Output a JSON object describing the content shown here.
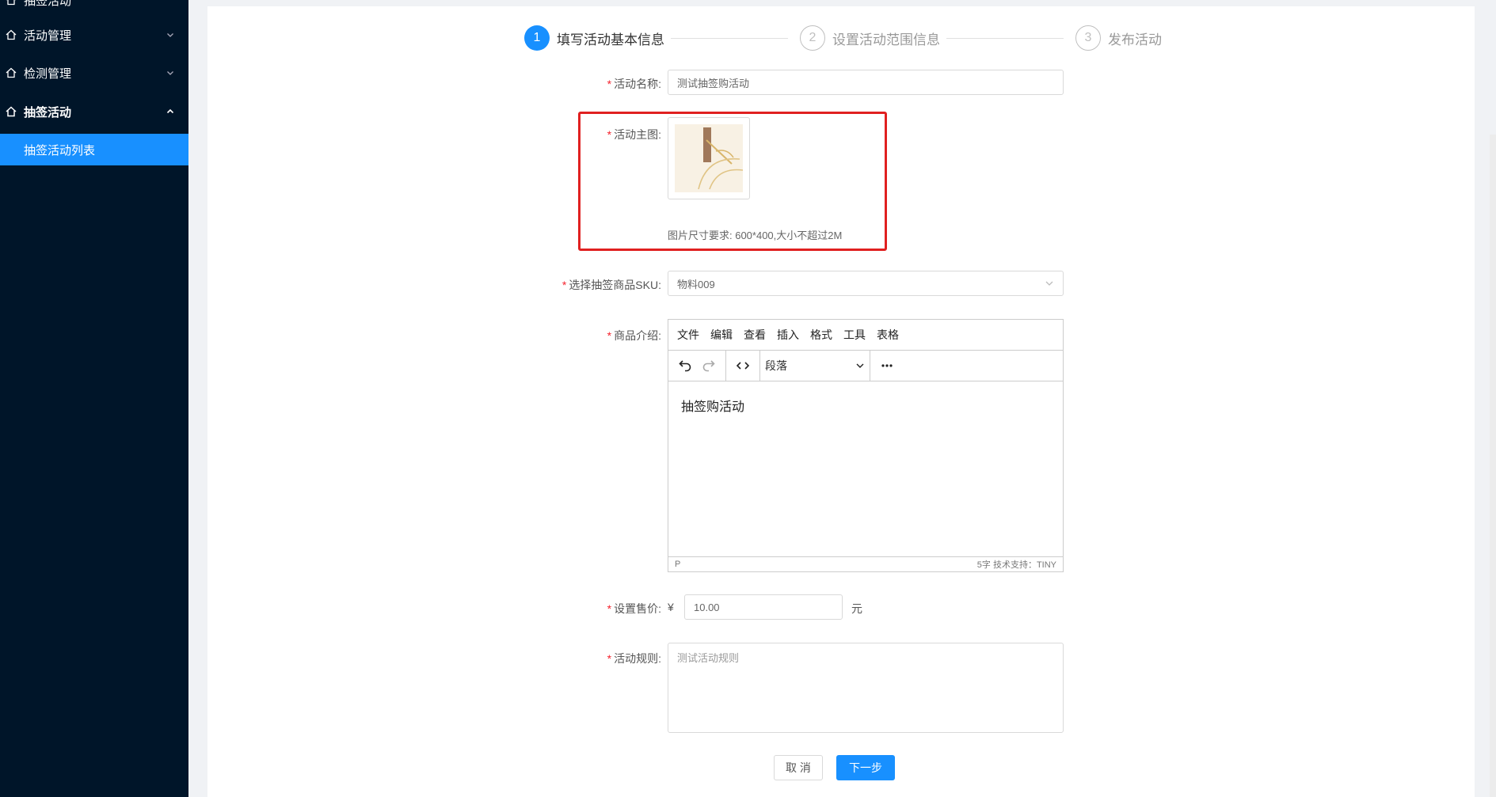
{
  "sidebar": {
    "items": [
      {
        "label": "抽签活动"
      },
      {
        "label": "活动管理"
      },
      {
        "label": "检测管理"
      },
      {
        "label": "抽签活动"
      },
      {
        "label": "抽签活动列表"
      }
    ]
  },
  "steps": [
    {
      "num": "1",
      "title": "填写活动基本信息"
    },
    {
      "num": "2",
      "title": "设置活动范围信息"
    },
    {
      "num": "3",
      "title": "发布活动"
    }
  ],
  "form": {
    "name_label": "活动名称:",
    "name_value": "测试抽签购活动",
    "image_label": "活动主图:",
    "image_hint": "图片尺寸要求: 600*400,大小不超过2M",
    "sku_label": "选择抽签商品SKU:",
    "sku_value": "物料009",
    "intro_label": "商品介绍:",
    "price_label": "设置售价:",
    "price_prefix": "¥",
    "price_value": "10.00",
    "price_unit": "元",
    "rules_label": "活动规则:",
    "rules_value": "测试活动规则",
    "required_mark": "*"
  },
  "editor": {
    "menus": [
      "文件",
      "编辑",
      "查看",
      "插入",
      "格式",
      "工具",
      "表格"
    ],
    "block_format": "段落",
    "content": "抽签购活动",
    "status_path": "P",
    "status_right": "5字  技术支持：TINY"
  },
  "buttons": {
    "cancel": "取 消",
    "next": "下一步"
  },
  "colors": {
    "sidebar_bg": "#001529",
    "active_menu": "#1890ff",
    "highlight": "#e02020"
  }
}
